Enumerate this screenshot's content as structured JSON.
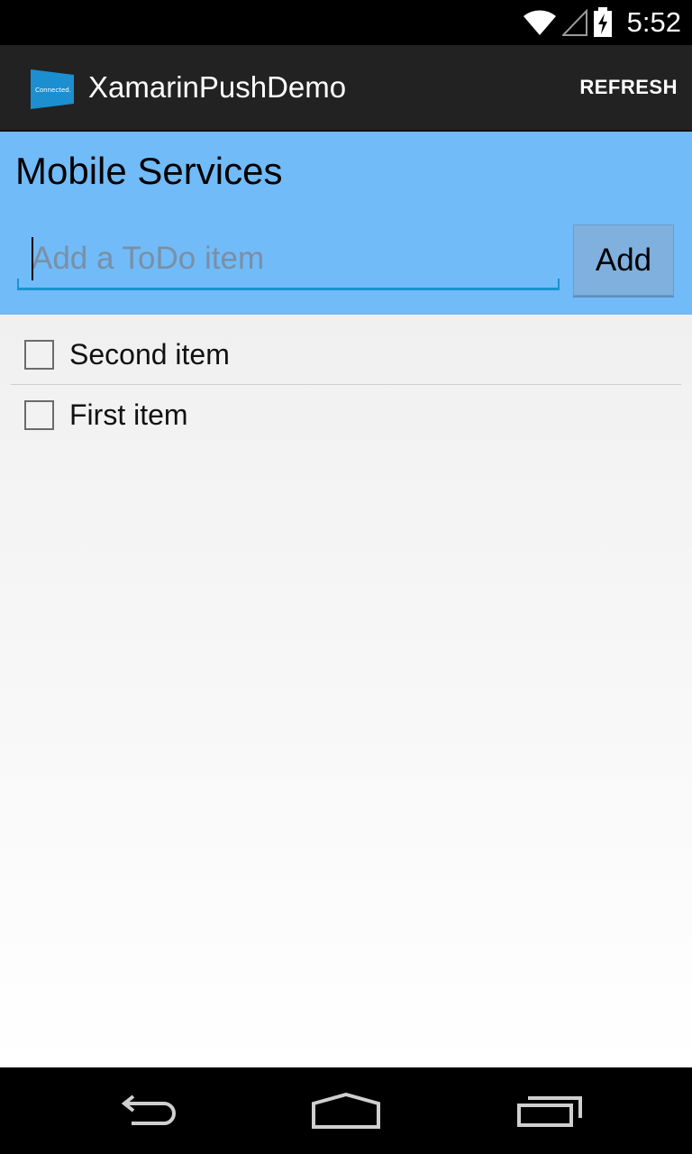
{
  "status_bar": {
    "time": "5:52",
    "icons": [
      "wifi-icon",
      "signal-icon",
      "battery-charging-icon"
    ]
  },
  "action_bar": {
    "logo_text": "Connected.",
    "app_title": "XamarinPushDemo",
    "refresh_label": "REFRESH"
  },
  "header": {
    "title": "Mobile Services",
    "input_placeholder": "Add a ToDo item",
    "input_value": "",
    "add_label": "Add"
  },
  "todo_items": [
    {
      "label": "Second item",
      "checked": false
    },
    {
      "label": "First item",
      "checked": false
    }
  ],
  "nav_bar": {
    "icons": [
      "back-icon",
      "home-icon",
      "recents-icon"
    ]
  },
  "colors": {
    "header_bg": "#71bbf8",
    "accent": "#1a94d0",
    "add_button_bg": "#7fb0de"
  }
}
